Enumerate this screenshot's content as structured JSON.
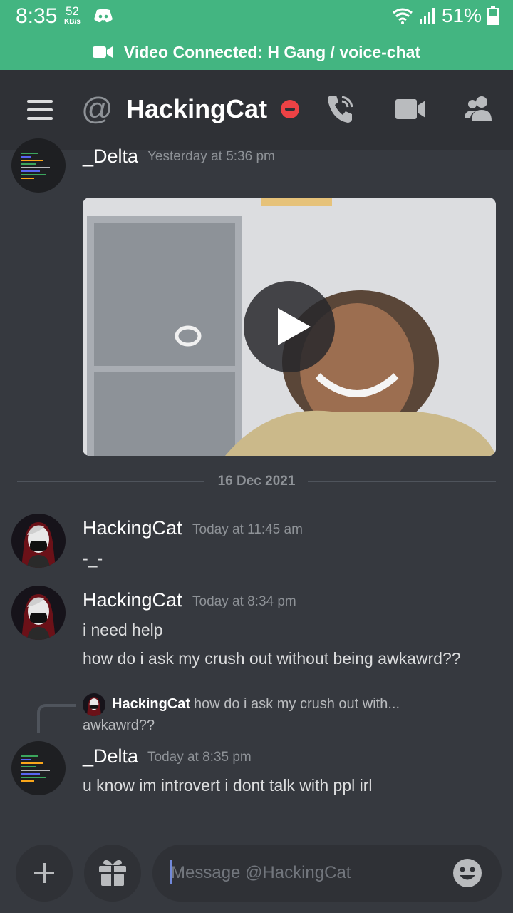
{
  "status_bar": {
    "time": "8:35",
    "speed_value": "52",
    "speed_unit": "KB/s",
    "battery": "51%"
  },
  "voice_banner": {
    "label": "Video Connected: H Gang / voice-chat"
  },
  "header": {
    "title": "HackingCat",
    "at_symbol": "@"
  },
  "messages": [
    {
      "author": "_Delta",
      "timestamp": "Yesterday at 5:36 pm",
      "attachment": "video"
    },
    {
      "author": "HackingCat",
      "timestamp": "Today at 11:45 am",
      "lines": [
        "-_-"
      ]
    },
    {
      "author": "HackingCat",
      "timestamp": "Today at 8:34 pm",
      "lines": [
        "i need help",
        "how do i ask my crush out without being awkawrd??"
      ]
    },
    {
      "author": "_Delta",
      "timestamp": "Today at 8:35 pm",
      "lines": [
        "u know im introvert i dont talk with ppl irl"
      ],
      "reply_to": {
        "author": "HackingCat",
        "text": "how do i ask my crush out with...",
        "text_cont": "awkawrd??"
      }
    }
  ],
  "date_divider": "16 Dec 2021",
  "composer": {
    "placeholder": "Message @HackingCat"
  },
  "colors": {
    "accent_green": "#43b581",
    "background": "#36393f",
    "header": "#2f3136",
    "dnd_red": "#ed4245"
  },
  "icons": [
    "discord-icon",
    "wifi-icon",
    "signal-icon",
    "battery-icon",
    "video-camera-icon",
    "menu-icon",
    "at-icon",
    "dnd-status-icon",
    "call-icon",
    "video-call-icon",
    "members-icon",
    "play-icon",
    "plus-icon",
    "gift-icon",
    "emoji-icon"
  ]
}
